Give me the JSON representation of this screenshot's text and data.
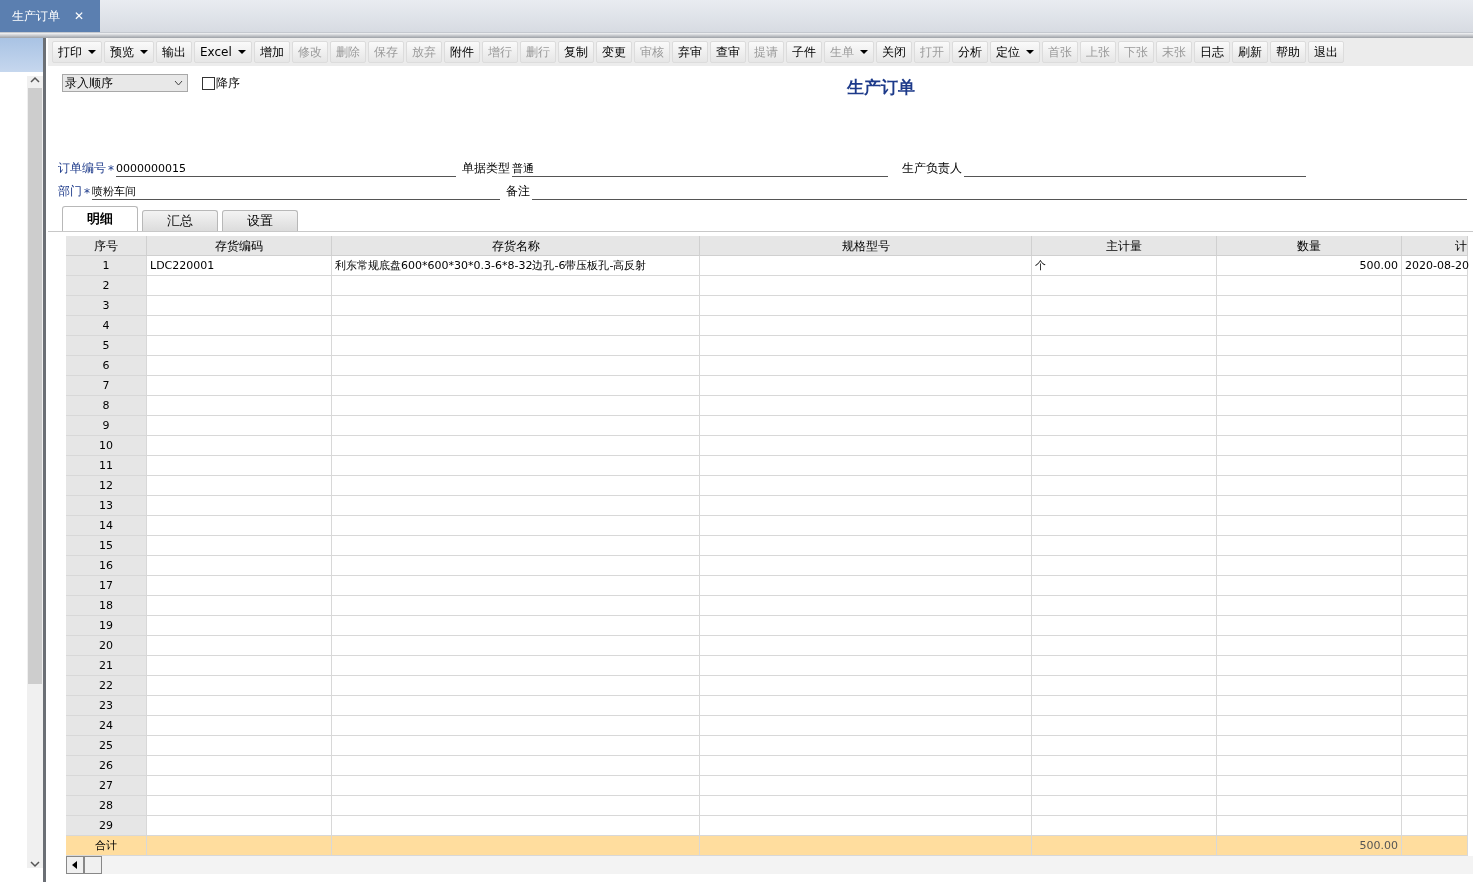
{
  "doc_tab": {
    "label": "生产订单",
    "close": "✕"
  },
  "toolbar": [
    {
      "label": "打印",
      "disabled": false,
      "dropdown": true
    },
    {
      "label": "预览",
      "disabled": false,
      "dropdown": true
    },
    {
      "label": "输出",
      "disabled": false,
      "dropdown": false
    },
    {
      "label": "Excel",
      "disabled": false,
      "dropdown": true
    },
    {
      "label": "增加",
      "disabled": false,
      "dropdown": false
    },
    {
      "label": "修改",
      "disabled": true,
      "dropdown": false
    },
    {
      "label": "删除",
      "disabled": true,
      "dropdown": false
    },
    {
      "label": "保存",
      "disabled": true,
      "dropdown": false
    },
    {
      "label": "放弃",
      "disabled": true,
      "dropdown": false
    },
    {
      "label": "附件",
      "disabled": false,
      "dropdown": false
    },
    {
      "label": "增行",
      "disabled": true,
      "dropdown": false
    },
    {
      "label": "删行",
      "disabled": true,
      "dropdown": false
    },
    {
      "label": "复制",
      "disabled": false,
      "dropdown": false
    },
    {
      "label": "变更",
      "disabled": false,
      "dropdown": false
    },
    {
      "label": "审核",
      "disabled": true,
      "dropdown": false
    },
    {
      "label": "弃审",
      "disabled": false,
      "dropdown": false
    },
    {
      "label": "查审",
      "disabled": false,
      "dropdown": false
    },
    {
      "label": "提请",
      "disabled": true,
      "dropdown": false
    },
    {
      "label": "子件",
      "disabled": false,
      "dropdown": false
    },
    {
      "label": "生单",
      "disabled": true,
      "dropdown": true
    },
    {
      "label": "关闭",
      "disabled": false,
      "dropdown": false
    },
    {
      "label": "打开",
      "disabled": true,
      "dropdown": false
    },
    {
      "label": "分析",
      "disabled": false,
      "dropdown": false
    },
    {
      "label": "定位",
      "disabled": false,
      "dropdown": true
    },
    {
      "label": "首张",
      "disabled": true,
      "dropdown": false
    },
    {
      "label": "上张",
      "disabled": true,
      "dropdown": false
    },
    {
      "label": "下张",
      "disabled": true,
      "dropdown": false
    },
    {
      "label": "末张",
      "disabled": true,
      "dropdown": false
    },
    {
      "label": "日志",
      "disabled": false,
      "dropdown": false
    },
    {
      "label": "刷新",
      "disabled": false,
      "dropdown": false
    },
    {
      "label": "帮助",
      "disabled": false,
      "dropdown": false
    },
    {
      "label": "退出",
      "disabled": false,
      "dropdown": false
    }
  ],
  "sort": {
    "value": "录入顺序",
    "descending": {
      "label": "降序",
      "checked": false
    }
  },
  "title": "生产订单",
  "fields": [
    [
      {
        "label": "订单编号",
        "required_mark": "*",
        "value": "0000000015"
      },
      {
        "label": "单据类型",
        "value": "普通"
      },
      {
        "label": "生产负责人"
      }
    ],
    [
      {
        "label": "部门",
        "required_mark": "*",
        "value": "喷粉车间"
      },
      {
        "label": "备注"
      }
    ]
  ],
  "tabs": [
    {
      "label": "明细",
      "selected": true
    },
    {
      "label": "汇总",
      "selected": false
    },
    {
      "label": "设置",
      "selected": false
    }
  ],
  "table": {
    "columns": [
      "序号",
      "存货编码",
      "存货名称",
      "规格型号",
      "主计量",
      "数量",
      "计"
    ],
    "rows": [
      [
        "1",
        "LDC220001",
        "利东常规底盘600*600*30*0.3-6*8-32边孔-6带压板孔-高反射",
        null,
        "个",
        "500.00",
        "2020-08-20"
      ],
      [
        "2"
      ],
      [
        "3"
      ],
      [
        "4"
      ],
      [
        "5"
      ],
      [
        "6"
      ],
      [
        "7"
      ],
      [
        "8"
      ],
      [
        "9"
      ],
      [
        "10"
      ],
      [
        "11"
      ],
      [
        "12"
      ],
      [
        "13"
      ],
      [
        "14"
      ],
      [
        "15"
      ],
      [
        "16"
      ],
      [
        "17"
      ],
      [
        "18"
      ],
      [
        "19"
      ],
      [
        "20"
      ],
      [
        "21"
      ],
      [
        "22"
      ],
      [
        "23"
      ],
      [
        "24"
      ],
      [
        "25"
      ],
      [
        "26"
      ],
      [
        "27"
      ],
      [
        "28"
      ],
      [
        "29"
      ]
    ],
    "total": {
      "label": "合计",
      "quantity": "500.00"
    }
  }
}
